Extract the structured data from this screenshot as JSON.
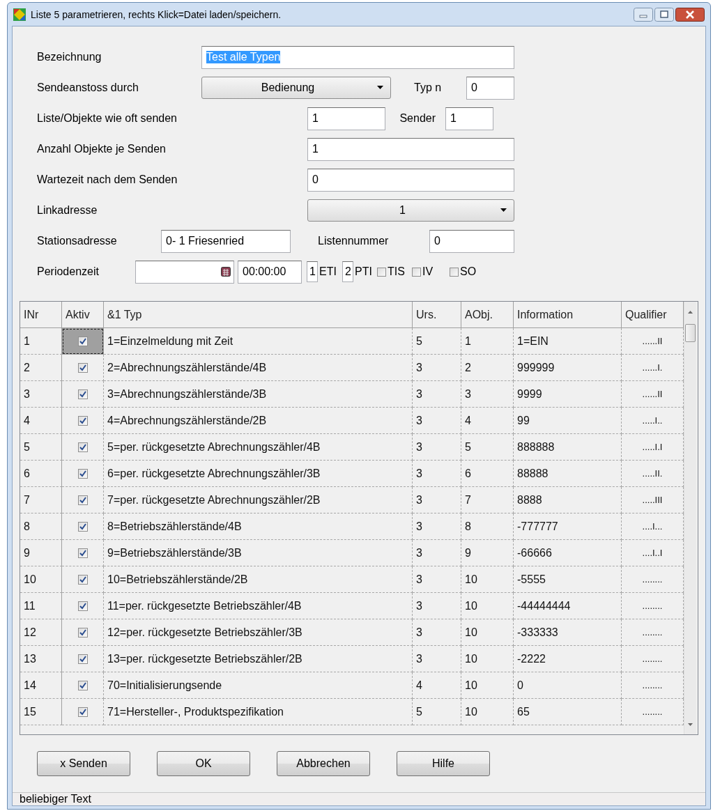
{
  "window": {
    "title": "Liste 5 parametrieren, rechts Klick=Datei laden/speichern."
  },
  "form": [
    {
      "items": [
        {
          "kind": "label",
          "text": "Bezeichnung"
        },
        {
          "kind": "text",
          "value": "Test alle Typen",
          "text_selected": true
        }
      ]
    },
    {
      "items": [
        {
          "kind": "label",
          "text": "Sendeanstoss durch"
        },
        {
          "kind": "dropdown",
          "value": "Bedienung"
        },
        {
          "kind": "label",
          "text": "Typ n"
        },
        {
          "kind": "text",
          "value": "0",
          "text_selected": false
        }
      ]
    },
    {
      "items": [
        {
          "kind": "label",
          "text": "Liste/Objekte wie oft senden"
        },
        {
          "kind": "text",
          "value": "1",
          "text_selected": false
        },
        {
          "kind": "label",
          "text": "Sender"
        },
        {
          "kind": "text",
          "value": "1",
          "text_selected": false
        }
      ]
    },
    {
      "items": [
        {
          "kind": "label",
          "text": "Anzahl Objekte je Senden"
        },
        {
          "kind": "text",
          "value": "1",
          "text_selected": false
        }
      ]
    },
    {
      "items": [
        {
          "kind": "label",
          "text": "Wartezeit nach dem Senden"
        },
        {
          "kind": "text",
          "value": "0",
          "text_selected": false
        }
      ]
    },
    {
      "items": [
        {
          "kind": "label",
          "text": "Linkadresse"
        },
        {
          "kind": "dropdown",
          "value": "1"
        }
      ]
    },
    {
      "items": [
        {
          "kind": "label",
          "text": "Stationsadresse"
        },
        {
          "kind": "text",
          "value": "0- 1 Friesenried",
          "text_selected": false
        },
        {
          "kind": "label",
          "text": "Listennummer"
        },
        {
          "kind": "text",
          "value": "0",
          "text_selected": false
        }
      ]
    },
    {
      "items": [
        {
          "kind": "label",
          "text": "Periodenzeit"
        },
        {
          "kind": "date"
        },
        {
          "kind": "text",
          "value": "00:00:00",
          "text_selected": false
        },
        {
          "kind": "text",
          "value": "1",
          "text_selected": false
        },
        {
          "kind": "label",
          "text": "ETI"
        },
        {
          "kind": "text",
          "value": "2",
          "text_selected": false
        },
        {
          "kind": "label",
          "text": "PTI"
        },
        {
          "kind": "checkbox",
          "text": "TIS",
          "checked": false
        },
        {
          "kind": "checkbox",
          "text": "IV",
          "checked": false
        },
        {
          "kind": "checkbox",
          "text": "SO",
          "checked": false
        }
      ]
    }
  ],
  "table": {
    "columns": [
      "INr",
      "Aktiv",
      "&1 Typ",
      "Urs.",
      "AObj.",
      "Information",
      "Qualifier"
    ],
    "rows": [
      {
        "nr": "1",
        "aktiv": true,
        "typ": "1=Einzelmeldung mit Zeit",
        "urs": "5",
        "aobj": "1",
        "information": "1=EIN",
        "qualifier": "......II",
        "selected": true
      },
      {
        "nr": "2",
        "aktiv": true,
        "typ": "2=Abrechnungszählerstände/4B",
        "urs": "3",
        "aobj": "2",
        "information": "999999",
        "qualifier": "......I.",
        "selected": false
      },
      {
        "nr": "3",
        "aktiv": true,
        "typ": "3=Abrechnungszählerstände/3B",
        "urs": "3",
        "aobj": "3",
        "information": "9999",
        "qualifier": "......II",
        "selected": false
      },
      {
        "nr": "4",
        "aktiv": true,
        "typ": "4=Abrechnungszählerstände/2B",
        "urs": "3",
        "aobj": "4",
        "information": "99",
        "qualifier": ".....I..",
        "selected": false
      },
      {
        "nr": "5",
        "aktiv": true,
        "typ": "5=per. rückgesetzte Abrechnungszähler/4B",
        "urs": "3",
        "aobj": "5",
        "information": "888888",
        "qualifier": ".....I.I",
        "selected": false
      },
      {
        "nr": "6",
        "aktiv": true,
        "typ": "6=per. rückgesetzte Abrechnungszähler/3B",
        "urs": "3",
        "aobj": "6",
        "information": "88888",
        "qualifier": ".....II.",
        "selected": false
      },
      {
        "nr": "7",
        "aktiv": true,
        "typ": "7=per. rückgesetzte Abrechnungszähler/2B",
        "urs": "3",
        "aobj": "7",
        "information": "8888",
        "qualifier": ".....III",
        "selected": false
      },
      {
        "nr": "8",
        "aktiv": true,
        "typ": "8=Betriebszählerstände/4B",
        "urs": "3",
        "aobj": "8",
        "information": "-777777",
        "qualifier": "....I...",
        "selected": false
      },
      {
        "nr": "9",
        "aktiv": true,
        "typ": "9=Betriebszählerstände/3B",
        "urs": "3",
        "aobj": "9",
        "information": "-66666",
        "qualifier": "....I..I",
        "selected": false
      },
      {
        "nr": "10",
        "aktiv": true,
        "typ": "10=Betriebszählerstände/2B",
        "urs": "3",
        "aobj": "10",
        "information": "-5555",
        "qualifier": "........",
        "selected": false
      },
      {
        "nr": "11",
        "aktiv": true,
        "typ": "11=per. rückgesetzte Betriebszähler/4B",
        "urs": "3",
        "aobj": "10",
        "information": "-44444444",
        "qualifier": "........",
        "selected": false
      },
      {
        "nr": "12",
        "aktiv": true,
        "typ": "12=per. rückgesetzte Betriebszähler/3B",
        "urs": "3",
        "aobj": "10",
        "information": "-333333",
        "qualifier": "........",
        "selected": false
      },
      {
        "nr": "13",
        "aktiv": true,
        "typ": "13=per. rückgesetzte Betriebszähler/2B",
        "urs": "3",
        "aobj": "10",
        "information": "-2222",
        "qualifier": "........",
        "selected": false
      },
      {
        "nr": "14",
        "aktiv": true,
        "typ": "70=Initialisierungsende",
        "urs": "4",
        "aobj": "10",
        "information": "0",
        "qualifier": "........",
        "selected": false
      },
      {
        "nr": "15",
        "aktiv": true,
        "typ": "71=Hersteller-, Produktspezifikation",
        "urs": "5",
        "aobj": "10",
        "information": "65",
        "qualifier": "........",
        "selected": false
      }
    ]
  },
  "buttons": [
    {
      "label": "x Senden"
    },
    {
      "label": "OK"
    },
    {
      "label": "Abbrechen"
    },
    {
      "label": "Hilfe"
    }
  ],
  "status_bar": "beliebiger Text"
}
